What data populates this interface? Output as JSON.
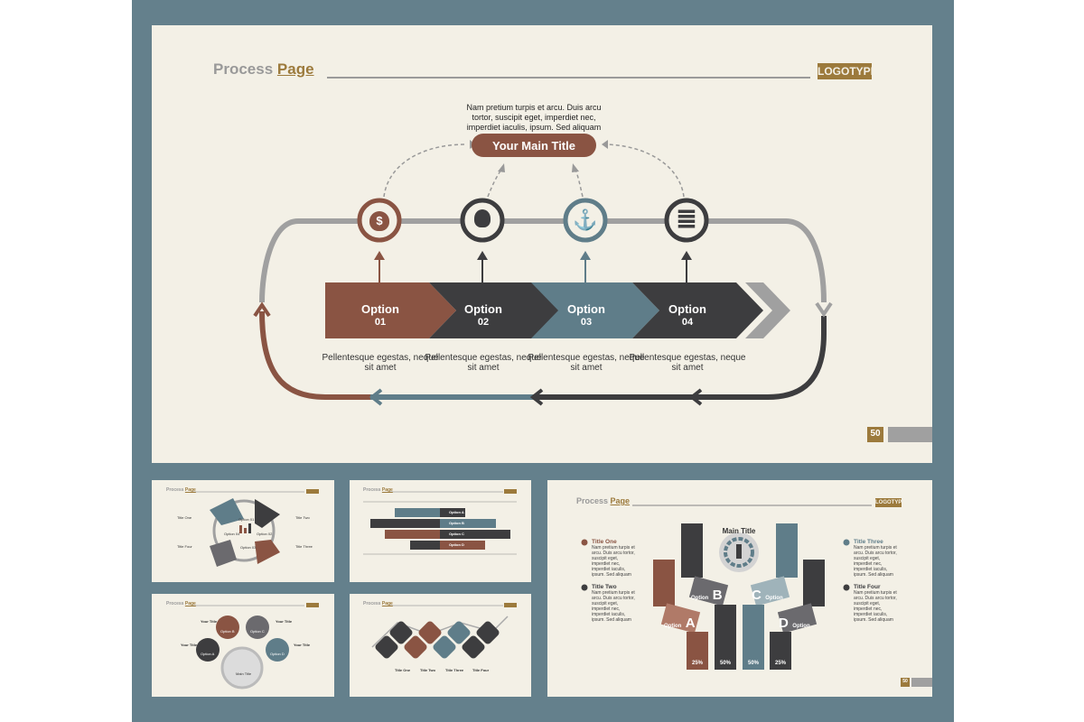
{
  "colors": {
    "frame": "#64808c",
    "paper": "#f3f0e6",
    "brown": "#8a5443",
    "dark": "#3d3d3f",
    "slate": "#5f7d89",
    "gold": "#9c7a3c",
    "gray": "#a0a0a0"
  },
  "main_slide": {
    "header": {
      "word1": "Process",
      "word2": "Page",
      "logo": "LOGOTYPE"
    },
    "intro": "Nam pretium turpis et arcu. Duis arcu tortor, suscipit eget, imperdiet nec, imperdiet iaculis, ipsum. Sed aliquam",
    "main_title": "Your Main Title",
    "options": [
      {
        "label": "Option",
        "num": "01",
        "icon": "money-bag-icon",
        "glyph": "$",
        "desc": "Pellentesque egestas, neque sit amet"
      },
      {
        "label": "Option",
        "num": "02",
        "icon": "lightbulb-icon",
        "glyph": "💡",
        "desc": "Pellentesque egestas, neque sit amet"
      },
      {
        "label": "Option",
        "num": "03",
        "icon": "anchor-icon",
        "glyph": "⚓",
        "desc": "Pellentesque egestas, neque sit amet"
      },
      {
        "label": "Option",
        "num": "04",
        "icon": "coins-stack-icon",
        "glyph": "≣",
        "desc": "Pellentesque egestas, neque sit amet"
      }
    ],
    "page_number": "50"
  },
  "thumbs": {
    "header": {
      "word1": "Process",
      "word2": "Page",
      "logo": "LOGOTYPE"
    },
    "cycle": {
      "titles": [
        "Title One",
        "Title Two",
        "Title Three",
        "Title Four"
      ],
      "options": [
        "Option 01",
        "Option 02",
        "Option 03",
        "Option 04"
      ]
    },
    "bars": {
      "options": [
        "Option A",
        "Option B",
        "Option C",
        "Option D"
      ]
    },
    "bubbles": {
      "center": "Main Title",
      "titles": [
        "Your Title",
        "Your Title",
        "Your Title",
        "Your Title"
      ],
      "options": [
        "Option A",
        "Option B",
        "Option C",
        "Option D"
      ]
    },
    "zigzag": {
      "titles": [
        "Title One",
        "Title Two",
        "Title Three",
        "Title Four"
      ]
    }
  },
  "large_slide": {
    "header": {
      "word1": "Process",
      "word2": "Page",
      "logo": "LOGOTYPE"
    },
    "main_title": "Main Title",
    "side_titles": [
      {
        "title": "Title One",
        "text": "Nam pretium turpis et arcu. Duis arcu tortor, suscipit eget, imperdiet nec, imperdiet iaculis, ipsum. Sed aliquam"
      },
      {
        "title": "Title Two",
        "text": "Nam pretium turpis et arcu. Duis arcu tortor, suscipit eget, imperdiet nec, imperdiet iaculis, ipsum. Sed aliquam"
      },
      {
        "title": "Title Three",
        "text": "Nam pretium turpis et arcu. Duis arcu tortor, suscipit eget, imperdiet nec, imperdiet iaculis, ipsum. Sed aliquam"
      },
      {
        "title": "Title Four",
        "text": "Nam pretium turpis et arcu. Duis arcu tortor, suscipit eget, imperdiet nec, imperdiet iaculis, ipsum. Sed aliquam"
      }
    ],
    "options": [
      {
        "label": "Option",
        "letter": "A",
        "percent": "25%"
      },
      {
        "label": "Option",
        "letter": "B",
        "percent": "50%"
      },
      {
        "label": "Option",
        "letter": "C",
        "percent": "50%"
      },
      {
        "label": "Option",
        "letter": "D",
        "percent": "25%"
      }
    ],
    "page_number": "50"
  }
}
